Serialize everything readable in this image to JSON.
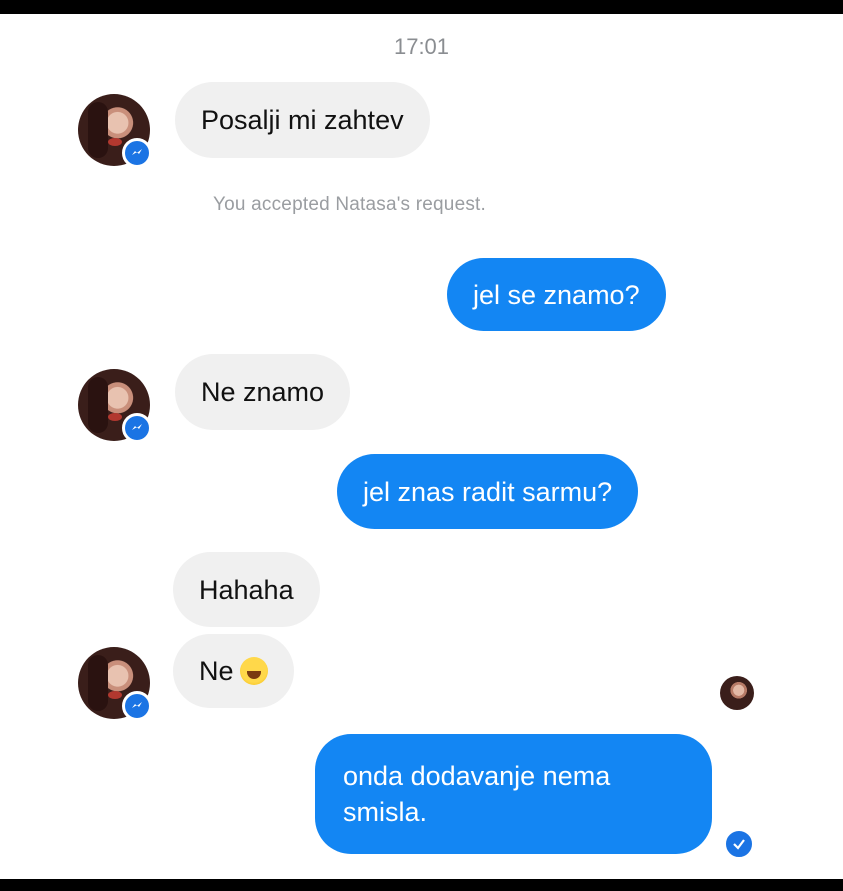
{
  "chat": {
    "timestamp": "17:01",
    "system_note": "You accepted Natasa's request.",
    "messages": [
      {
        "from": "them",
        "text": "Posalji mi zahtev"
      },
      {
        "from": "me",
        "text": "jel se znamo?"
      },
      {
        "from": "them",
        "text": "Ne znamo"
      },
      {
        "from": "me",
        "text": "jel znas radit sarmu?"
      },
      {
        "from": "them",
        "text": "Hahaha"
      },
      {
        "from": "them",
        "text": "Ne",
        "emoji": "face-with-tears-of-joy"
      },
      {
        "from": "me",
        "line1": "onda dodavanje nema",
        "line2": "smisla."
      }
    ]
  },
  "colors": {
    "outgoing_bubble": "#1386f3",
    "incoming_bubble": "#f0f0f0",
    "badge": "#1b74e4",
    "timestamp_text": "#8a8d91"
  },
  "icons": [
    "messenger-badge-icon",
    "seen-avatar-icon",
    "delivered-check-icon"
  ]
}
